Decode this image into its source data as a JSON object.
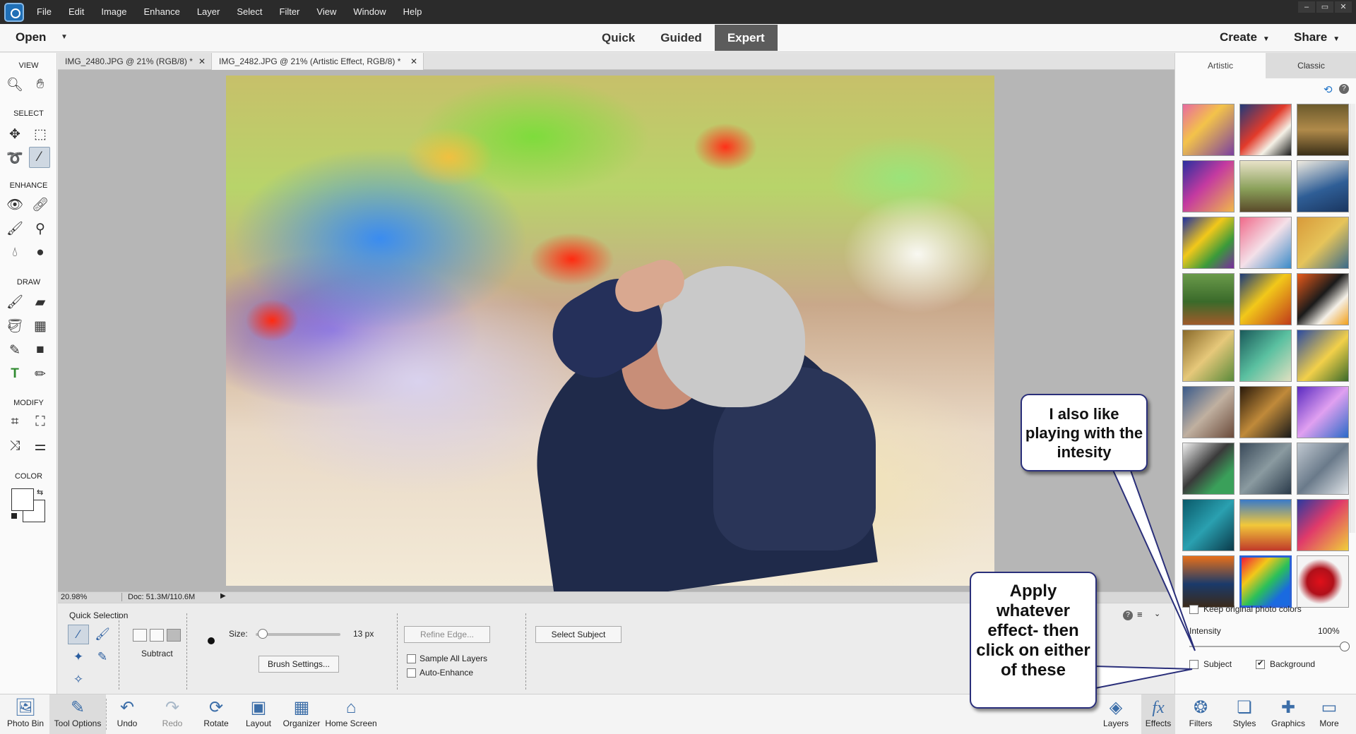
{
  "menubar": {
    "items": [
      "File",
      "Edit",
      "Image",
      "Enhance",
      "Layer",
      "Select",
      "Filter",
      "View",
      "Window",
      "Help"
    ],
    "window_controls": [
      "–",
      "▭",
      "✕"
    ]
  },
  "modebar": {
    "open_label": "Open",
    "modes": [
      "Quick",
      "Guided",
      "Expert"
    ],
    "active_mode": "Expert",
    "create_label": "Create",
    "share_label": "Share"
  },
  "toolbar": {
    "sections": [
      "VIEW",
      "SELECT",
      "ENHANCE",
      "DRAW",
      "MODIFY",
      "COLOR"
    ]
  },
  "tabs": [
    {
      "label": "IMG_2480.JPG @ 21% (RGB/8) *"
    },
    {
      "label": "IMG_2482.JPG @ 21% (Artistic Effect, RGB/8) *"
    }
  ],
  "status": {
    "zoom": "20.98%",
    "doc": "Doc: 51.3M/110.6M"
  },
  "tool_options": {
    "title": "Quick Selection",
    "mode_label": "Subtract",
    "size_label": "Size:",
    "size_value": "13 px",
    "size_fraction": 0.05,
    "refine_edge": "Refine Edge...",
    "brush_settings": "Brush Settings...",
    "sample_all_layers": "Sample All Layers",
    "auto_enhance": "Auto-Enhance",
    "select_subject": "Select Subject"
  },
  "effects_panel": {
    "tabs": [
      "Artistic",
      "Classic"
    ],
    "active_tab": "Artistic",
    "selected_index": 25,
    "keep_colors_label": "Keep original photo colors",
    "intensity_label": "Intensity",
    "intensity_value": "100%",
    "intensity_fraction": 1.0,
    "subject_label": "Subject",
    "background_label": "Background",
    "background_checked": true
  },
  "bottom_bar": {
    "left": [
      {
        "label": "Photo Bin",
        "icon": "photo-bin-icon"
      },
      {
        "label": "Tool Options",
        "icon": "tool-options-icon"
      },
      {
        "label": "Undo",
        "icon": "undo-icon"
      },
      {
        "label": "Redo",
        "icon": "redo-icon"
      },
      {
        "label": "Rotate",
        "icon": "rotate-icon"
      },
      {
        "label": "Layout",
        "icon": "layout-icon"
      },
      {
        "label": "Organizer",
        "icon": "organizer-icon"
      },
      {
        "label": "Home Screen",
        "icon": "home-icon"
      }
    ],
    "right": [
      {
        "label": "Layers",
        "icon": "layers-icon"
      },
      {
        "label": "Effects",
        "icon": "fx-icon"
      },
      {
        "label": "Filters",
        "icon": "filters-icon"
      },
      {
        "label": "Styles",
        "icon": "styles-icon"
      },
      {
        "label": "Graphics",
        "icon": "graphics-icon"
      },
      {
        "label": "More",
        "icon": "more-icon"
      }
    ]
  },
  "callouts": {
    "intensity_note": "I also like playing with the intesity",
    "apply_note": "Apply whatever effect- then click on either of these"
  },
  "colors": {
    "accent": "#2a62d6",
    "menubar": "#2b2b2b",
    "active_mode": "#5c5c5c",
    "callout_border": "#2a2f7a"
  }
}
